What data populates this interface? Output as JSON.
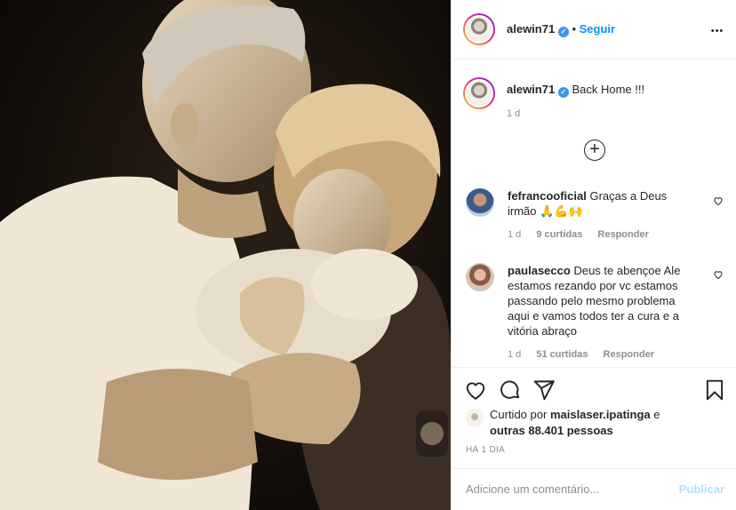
{
  "post": {
    "author": "alewin71",
    "follow_label": "Seguir",
    "separator": "•",
    "more_label": "•••",
    "caption": "Back Home !!!",
    "caption_time": "1 d",
    "load_more_label": "+"
  },
  "comments": [
    {
      "username": "fefrancooficial",
      "text": "Graças a Deus irmão 🙏💪🙌",
      "time": "1 d",
      "likes": "9 curtidas",
      "reply_label": "Responder"
    },
    {
      "username": "paulasecco",
      "text": "Deus te abençoe Ale estamos rezando por vc estamos passando pelo mesmo problema aqui e vamos todos ter a cura e a vitória abraço",
      "time": "1 d",
      "likes": "51 curtidas",
      "reply_label": "Responder"
    }
  ],
  "likes": {
    "prefix": "Curtido por",
    "user": "maislaser.ipatinga",
    "connector": "e",
    "others": "outras 88.401 pessoas"
  },
  "posted_ago": "HÁ 1 DIA",
  "add_comment": {
    "placeholder": "Adicione um comentário...",
    "publish_label": "Publicar"
  },
  "colors": {
    "accent": "#0095f6",
    "publish_disabled": "#b2dffc",
    "verified": "#3897f0",
    "muted": "#8e8e8e"
  },
  "icons": [
    "verified-badge-icon",
    "more-options-icon",
    "load-more-comments-icon",
    "heart-icon",
    "comment-icon",
    "share-icon",
    "bookmark-icon"
  ]
}
